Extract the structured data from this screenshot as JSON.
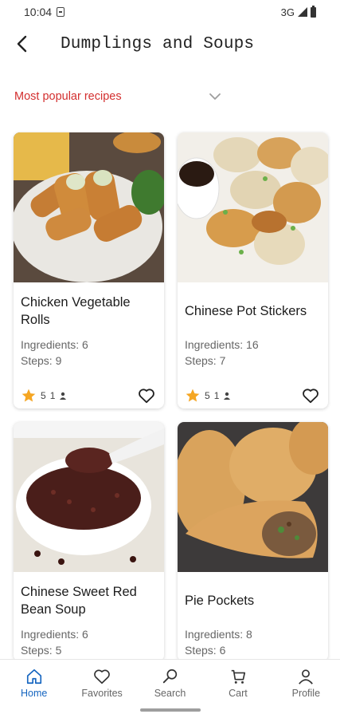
{
  "status_bar": {
    "time": "10:04",
    "network": "3G"
  },
  "header": {
    "title": "Dumplings and Soups"
  },
  "filter": {
    "label": "Most popular recipes"
  },
  "recipes": [
    {
      "title": "Chicken Vegetable Rolls",
      "ingredients": "Ingredients: 6",
      "steps": "Steps: 9",
      "rating": "5",
      "reviews": "1"
    },
    {
      "title": "Chinese Pot Stickers",
      "ingredients": "Ingredients: 16",
      "steps": "Steps: 7",
      "rating": "5",
      "reviews": "1"
    },
    {
      "title": "Chinese Sweet Red Bean Soup",
      "ingredients": "Ingredients: 6",
      "steps": "Steps: 5"
    },
    {
      "title": "Pie Pockets",
      "ingredients": "Ingredients: 8",
      "steps": "Steps: 6"
    }
  ],
  "nav": {
    "items": [
      {
        "label": "Home",
        "icon": "home-icon",
        "active": true
      },
      {
        "label": "Favorites",
        "icon": "heart-icon"
      },
      {
        "label": "Search",
        "icon": "search-icon"
      },
      {
        "label": "Cart",
        "icon": "cart-icon"
      },
      {
        "label": "Profile",
        "icon": "person-icon"
      }
    ]
  },
  "colors": {
    "accent": "#d32f2f",
    "active_nav": "#1565c0",
    "star": "#f5a623"
  }
}
